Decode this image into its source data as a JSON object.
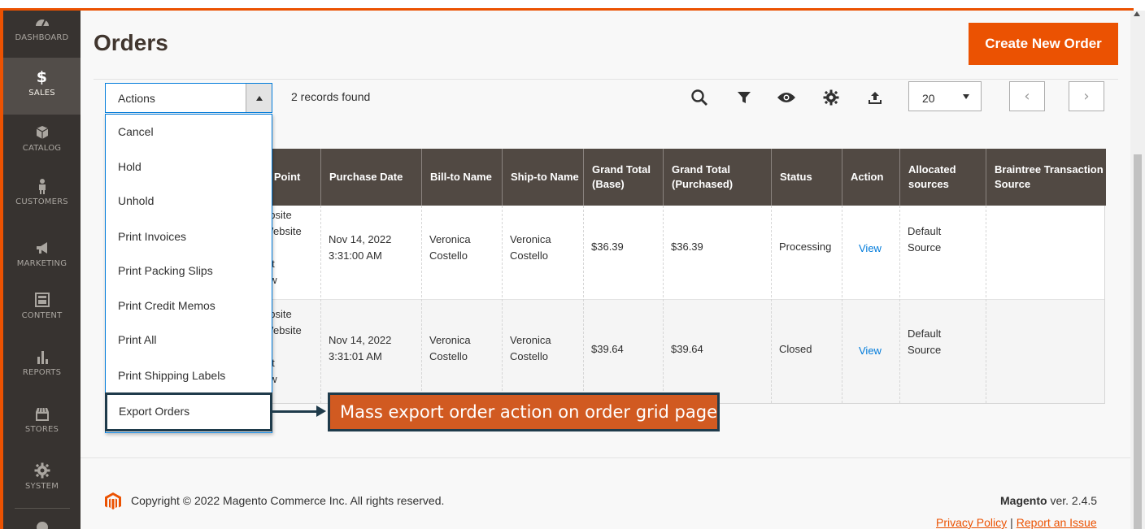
{
  "sidebar": {
    "items": [
      {
        "label": "DASHBOARD",
        "icon": "dashboard-icon"
      },
      {
        "label": "SALES",
        "icon": "dollar-icon"
      },
      {
        "label": "CATALOG",
        "icon": "box-icon"
      },
      {
        "label": "CUSTOMERS",
        "icon": "person-icon"
      },
      {
        "label": "MARKETING",
        "icon": "megaphone-icon"
      },
      {
        "label": "CONTENT",
        "icon": "layout-icon"
      },
      {
        "label": "REPORTS",
        "icon": "bar-chart-icon"
      },
      {
        "label": "STORES",
        "icon": "store-icon"
      },
      {
        "label": "SYSTEM",
        "icon": "gear-icon"
      }
    ]
  },
  "header": {
    "title": "Orders",
    "create_label": "Create New Order"
  },
  "toolbar": {
    "actions_label": "Actions",
    "records_text": "2 records found",
    "per_page": "20",
    "prev": "‹",
    "next": "›"
  },
  "dropdown": {
    "items": [
      "Cancel",
      "Hold",
      "Unhold",
      "Print Invoices",
      "Print Packing Slips",
      "Print Credit Memos",
      "Print All",
      "Print Shipping Labels",
      "Export Orders"
    ]
  },
  "callout": {
    "text": "Mass export order action on order grid page"
  },
  "grid": {
    "columns": [
      "e Point",
      "Purchase Date",
      "Bill-to Name",
      "Ship-to Name",
      "Grand Total (Base)",
      "Grand Total (Purchased)",
      "Status",
      "Action",
      "Allocated sources",
      "Braintree Transaction Source"
    ],
    "rows": [
      {
        "point_lines": [
          "ebsite",
          "Website",
          "",
          "ult",
          "ew"
        ],
        "purchase_date": [
          "Nov 14, 2022",
          "3:31:00 AM"
        ],
        "bill_to": [
          "Veronica",
          "Costello"
        ],
        "ship_to": [
          "Veronica",
          "Costello"
        ],
        "grand_total_base": "$36.39",
        "grand_total_purchased": "$36.39",
        "status": "Processing",
        "action": "View",
        "allocated": [
          "Default",
          "Source"
        ]
      },
      {
        "point_lines": [
          "ebsite",
          "Website",
          "",
          "ult",
          "ew"
        ],
        "purchase_date": [
          "Nov 14, 2022",
          "3:31:01 AM"
        ],
        "bill_to": [
          "Veronica",
          "Costello"
        ],
        "ship_to": [
          "Veronica",
          "Costello"
        ],
        "grand_total_base": "$39.64",
        "grand_total_purchased": "$39.64",
        "status": "Closed",
        "action": "View",
        "allocated": [
          "Default",
          "Source"
        ]
      }
    ]
  },
  "footer": {
    "copyright": "Copyright © 2022 Magento Commerce Inc. All rights reserved.",
    "brand": "Magento",
    "version": " ver. 2.4.5",
    "privacy": "Privacy Policy",
    "separator": "|",
    "report": "Report an Issue"
  },
  "colors": {
    "accent": "#eb5202",
    "sidebar": "#373330",
    "table_header": "#514943",
    "link": "#007bdb",
    "callout": "#d15a21"
  }
}
